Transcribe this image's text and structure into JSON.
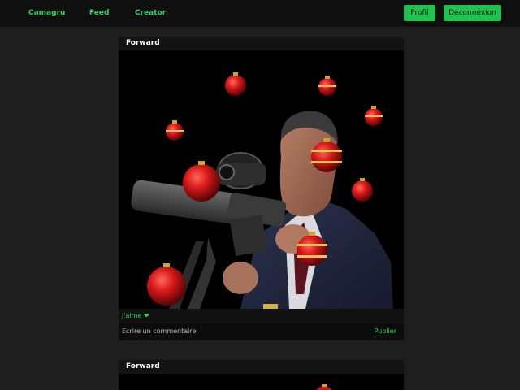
{
  "nav": {
    "links": [
      "Camagru",
      "Feed",
      "Creator"
    ],
    "profile_button": "Profil",
    "logout_button": "Déconnexion"
  },
  "posts": [
    {
      "header": "Forward",
      "image": "photo: man in suit aiming a scoped rifle, with red Christmas bauble stickers overlaid",
      "like_label": "J'aime ❤",
      "comment_placeholder": "Ecrire un commentaire",
      "publish_label": "Publier"
    },
    {
      "header": "Forward"
    }
  ],
  "colors": {
    "background": "#1e1e1e",
    "navbar": "#0f0f0f",
    "accent": "#21c24f",
    "card": "#0f0f0f"
  }
}
